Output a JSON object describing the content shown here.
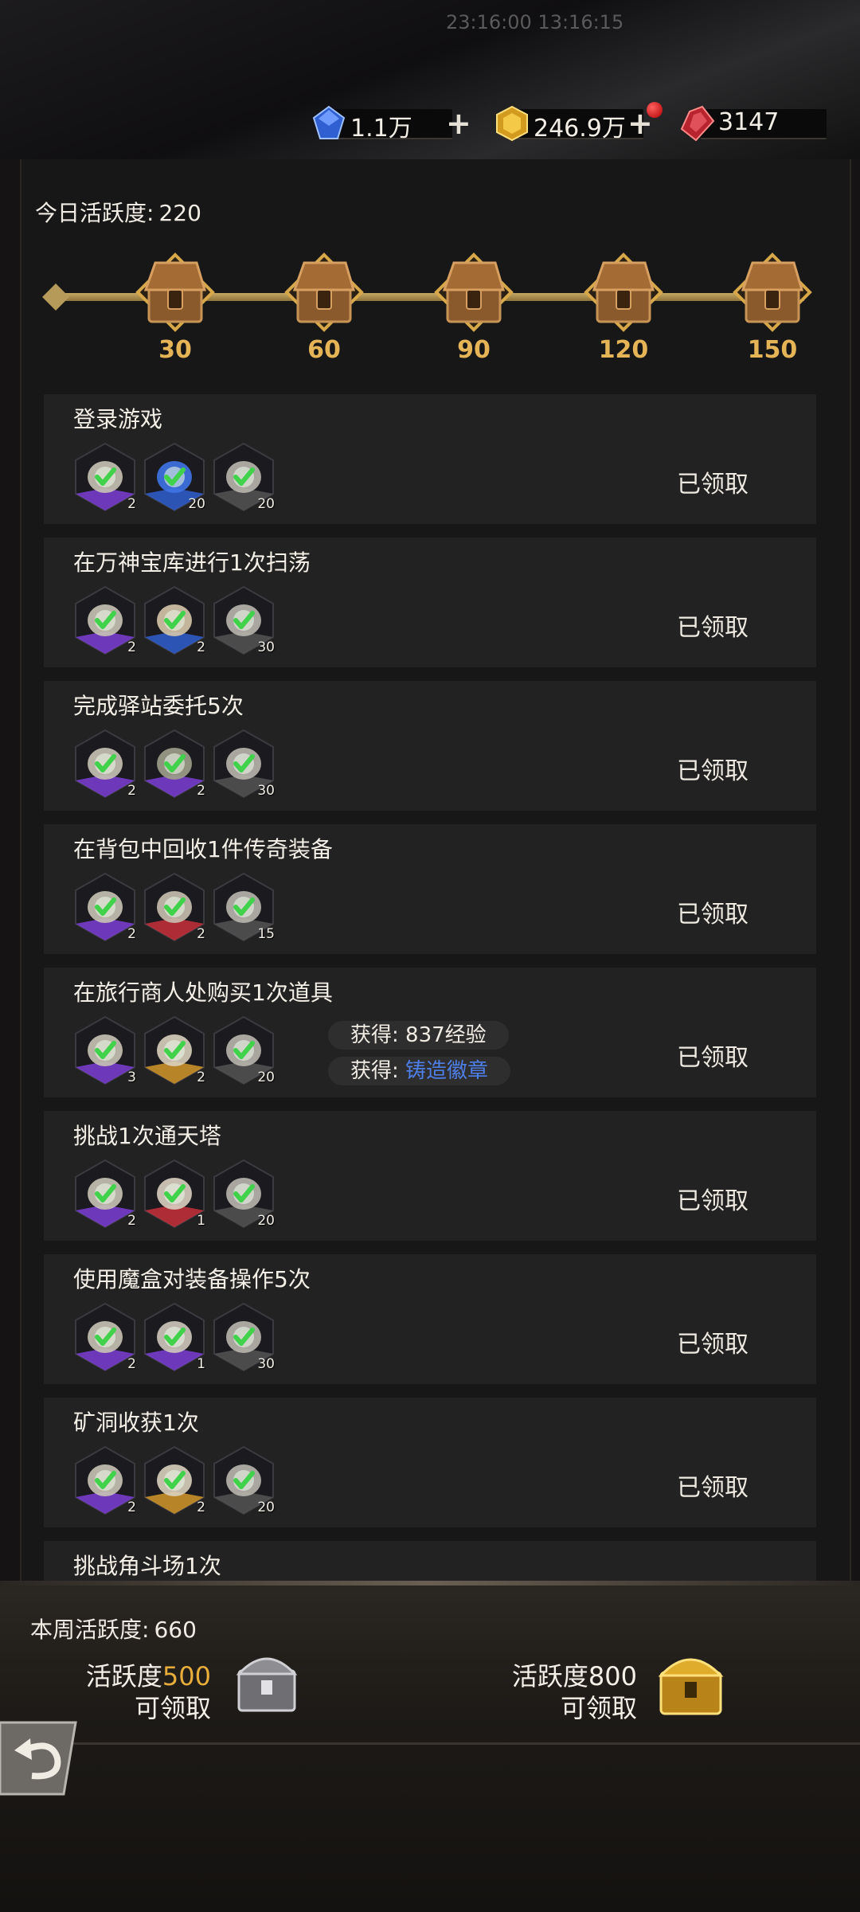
{
  "status": {
    "time": "23:16:00 13:16:15"
  },
  "currencies": [
    {
      "icon": "blue-diamond-icon",
      "value": "1.1万",
      "color": "#3f6fe0"
    },
    {
      "icon": "gold-gem-icon",
      "value": "246.9万",
      "color": "#e3b23c"
    },
    {
      "icon": "red-crystal-icon",
      "value": "3147",
      "color": "#c8303a"
    }
  ],
  "today": {
    "label": "今日活跃度:",
    "value": "220"
  },
  "milestones": [
    "30",
    "60",
    "90",
    "120",
    "150"
  ],
  "tasks": [
    {
      "title": "登录游戏",
      "status": "已领取",
      "rewards": [
        {
          "icon": "stone-icon",
          "frame": "purple",
          "count": "2"
        },
        {
          "icon": "blue-diamond-icon",
          "frame": "blue",
          "count": "20"
        },
        {
          "icon": "activity-coin-icon",
          "frame": "dark",
          "count": "20"
        }
      ]
    },
    {
      "title": "在万神宝库进行1次扫荡",
      "status": "已领取",
      "rewards": [
        {
          "icon": "stone-icon",
          "frame": "purple",
          "count": "2"
        },
        {
          "icon": "compass-icon",
          "frame": "blue",
          "count": "2"
        },
        {
          "icon": "activity-coin-icon",
          "frame": "dark",
          "count": "30"
        }
      ]
    },
    {
      "title": "完成驿站委托5次",
      "status": "已领取",
      "rewards": [
        {
          "icon": "stone-icon",
          "frame": "purple",
          "count": "2"
        },
        {
          "icon": "crystal-shard-icon",
          "frame": "purple",
          "count": "2"
        },
        {
          "icon": "activity-coin-icon",
          "frame": "dark",
          "count": "30"
        }
      ]
    },
    {
      "title": "在背包中回收1件传奇装备",
      "status": "已领取",
      "rewards": [
        {
          "icon": "stone-icon",
          "frame": "purple",
          "count": "2"
        },
        {
          "icon": "flame-icon",
          "frame": "red",
          "count": "2"
        },
        {
          "icon": "activity-coin-icon",
          "frame": "dark",
          "count": "15"
        }
      ]
    },
    {
      "title": "在旅行商人处购买1次道具",
      "status": "已领取",
      "rewards": [
        {
          "icon": "stone-icon",
          "frame": "purple",
          "count": "3"
        },
        {
          "icon": "sack-icon",
          "frame": "gold",
          "count": "2"
        },
        {
          "icon": "activity-coin-icon",
          "frame": "dark",
          "count": "20"
        }
      ]
    },
    {
      "title": "挑战1次通天塔",
      "status": "已领取",
      "rewards": [
        {
          "icon": "stone-icon",
          "frame": "purple",
          "count": "2"
        },
        {
          "icon": "scroll-icon",
          "frame": "red",
          "count": "1"
        },
        {
          "icon": "activity-coin-icon",
          "frame": "dark",
          "count": "20"
        }
      ]
    },
    {
      "title": "使用魔盒对装备操作5次",
      "status": "已领取",
      "rewards": [
        {
          "icon": "stone-icon",
          "frame": "purple",
          "count": "2"
        },
        {
          "icon": "paper-icon",
          "frame": "purple",
          "count": "1"
        },
        {
          "icon": "activity-coin-icon",
          "frame": "dark",
          "count": "30"
        }
      ]
    },
    {
      "title": "矿洞收获1次",
      "status": "已领取",
      "rewards": [
        {
          "icon": "stone-icon",
          "frame": "purple",
          "count": "2"
        },
        {
          "icon": "sack-icon",
          "frame": "gold",
          "count": "2"
        },
        {
          "icon": "activity-coin-icon",
          "frame": "dark",
          "count": "20"
        }
      ]
    },
    {
      "title": "挑战角斗场1次",
      "status": "",
      "rewards": []
    }
  ],
  "toasts": [
    {
      "prefix": "获得: ",
      "text": "837经验",
      "highlight": false
    },
    {
      "prefix": "获得: ",
      "text": "铸造徽章",
      "highlight": true
    }
  ],
  "weekly": {
    "label": "本周活跃度:",
    "value": "660",
    "rewards": [
      {
        "prefix": "活跃度",
        "num": "500",
        "action": "可领取",
        "chest": "silver-chest-icon"
      },
      {
        "prefix": "活跃度",
        "num": "800",
        "action": "可领取",
        "chest": "gold-chest-icon"
      }
    ]
  },
  "colors": {
    "accent_gold": "#e4b456",
    "claimed_text": "#eeeae2",
    "highlight_blue": "#4e7fe8"
  }
}
